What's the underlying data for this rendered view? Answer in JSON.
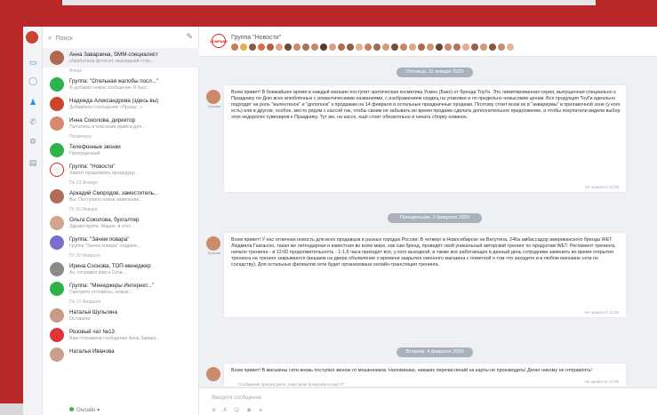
{
  "search": {
    "placeholder": "Поиск"
  },
  "chats": [
    {
      "name": "Анна Заварзина, SMM-специалист",
      "preview": "обработала фотосет, вышедший стор...",
      "color": "#b06a4e",
      "active": true
    },
    {
      "day": "Вчера"
    },
    {
      "name": "Группа: \"Отельная жалобы посл...\"",
      "preview": "Я добавил новое сообщение Я был...",
      "color": "#2db34a"
    },
    {
      "name": "Надежда Александрова (здесь вы)",
      "preview": "Добавлено сообщение «Прошу...»",
      "color": "#c9452b"
    },
    {
      "name": "Инна Соколова, директор",
      "preview": "Пытались в описании прайса для...",
      "color": "#d98a71"
    },
    {
      "day": "Позавчера"
    },
    {
      "name": "Телефонные звонки",
      "preview": "Пропущенный",
      "color": "#2db34a"
    },
    {
      "name": "Группа: \"Новости\"",
      "preview": "Хватит продолжать процедуру...",
      "color": "#ffffff"
    },
    {
      "day": "Пн 23 Января"
    },
    {
      "name": "Аркадий Смородов, заместитель...",
      "preview": "Вы: Поступило новое заявление...",
      "color": "#b36d54"
    },
    {
      "day": "Пт 20 Января"
    },
    {
      "name": "Ольга Соколова, бухгалтер",
      "preview": "Здравствуйте, Мария, в этот...",
      "color": "#d3a58c"
    },
    {
      "name": "Группа: \"Зачем повара\"",
      "preview": "Группа \"Зачем повара\" создана...",
      "color": "#7a6fcf"
    },
    {
      "day": "Пт 20 Февраля"
    },
    {
      "name": "Ирина Соснова, ТОП-менеджер",
      "preview": "Ах, отправил вам в Сочи...",
      "color": "#8a8a8a"
    },
    {
      "name": "Группа: \"Менеджеры Интернет...\"",
      "preview": "Смотрите отложены, новые...",
      "color": "#2db34a"
    },
    {
      "day": "Пн 17 Февраля"
    },
    {
      "name": "Наталья Шульгина",
      "preview": "Оставила",
      "color": "#c99b86"
    },
    {
      "name": "Розовый чат №13",
      "preview": "Вам отправили сообщение Анна Заварз...",
      "color": "#e0343a"
    },
    {
      "name": "Наталья Иванова",
      "preview": "",
      "color": "#c9a089"
    }
  ],
  "status": {
    "label": "Онлайн"
  },
  "header": {
    "title": "Группа \"Новости\"",
    "avatar_text": "COMPANY"
  },
  "members": [
    "#c97b5f",
    "#e8b04a",
    "#8a5a44",
    "#d56e4f",
    "#b45f40",
    "#e0a38a",
    "#6a4a3a",
    "#d18866",
    "#a6725a",
    "#c4876a",
    "#5a3a2a",
    "#d8a088",
    "#b36a50",
    "#8f5c48",
    "#e3b090",
    "#cf7b5c",
    "#9e6b55",
    "#d49a7c",
    "#7a4b38",
    "#c58363",
    "#e1a788",
    "#a8694d",
    "#d5916f",
    "#6b4535",
    "#cc8a6a",
    "#b87257",
    "#e4ad8e",
    "#9a5f46",
    "#d39977",
    "#8c5541",
    "#c98c6e",
    "#e5b596"
  ],
  "separators": [
    {
      "label": "Пятница, 31 января 2020"
    },
    {
      "label": "Понедельник, 3 февраля 2020"
    },
    {
      "label": "Вторник, 4 февраля 2020"
    }
  ],
  "messages": [
    {
      "author": "Ершова",
      "text": "Всем привет! В ближайшее время в каждый магазин поступит эротическая косметика Усмен (Бакс) от бренда ТоуГи. Это лимитированная серия, выпущенная специально к Празднику по Дню всех влюблённых с романтическими названиями, с изображением сердец на упаковке и по предельно невысоким ценам. Вся продукция ТоуГи идеально подходит на роль \"валентинок\" и \"дополнок\" к продажам на 14 февраля и остальные праздничные продажи. Поэтому стоит всем их в \"аквариумы\" в прилавочной зоне (у кого есть) или в другом, особое, место рядом с кассой так, чтобы своим не забывать во время продажи сделать дополнительное предложение, и чтобы покупатели видели выбор этих недорогих сувениров к Празднику. Тут же, на кассе, ещё стоит обязательно и начать сборку новинок.",
      "meta": "Не нравится  11:09"
    },
    {
      "author": "Ершова",
      "text": "Всем привет! У нас отличная новость для всех продавцов в разных городах России: В четверг в Новосибирске на Ватутина, 246а амбассадор американского бренда WET Людмила Гаальсон, такая же легендарная и известная во всём мире, как сам бренд, проведёт свой уникальный авторский тренинг по продуктам WET. Регламент тренинга, начало тренинга - в 12:00 продолжительность - 1-1,5 часа приходят все, у кого выходной, в также все работающие в данный день сотрудники заменить во время открытия тренинга на тренинг закрывается (вешаем на двери объявление о времени закрытия сменного магазина с пометкой о том что заходите и в любом магазине сети по соседству). Для остальных филиалов сети будет организована онлайн-трансляция тренинга.",
      "meta": "Не нравится  11:09"
    },
    {
      "author": "Ершова",
      "text": "Всем привет! В магазины сети вновь поступил звонок от мошенников. Напоминаю, никаких перечислений на карты не производить! Денег никому не отправлять!",
      "meta": "Не нравится  10:08"
    }
  ],
  "seen": "Сообщение просмотрели: Анастасия Кожанова и ещё 37",
  "composer": {
    "placeholder": "Введите сообщение"
  }
}
